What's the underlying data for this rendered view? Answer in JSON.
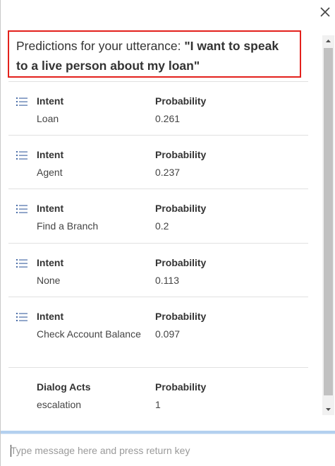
{
  "header": {
    "prefix": "Predictions for your utterance: ",
    "utterance": "\"I want to speak to a live person about my loan\""
  },
  "rows": [
    {
      "has_icon": true,
      "label_header": "Intent",
      "value": "Loan",
      "prob_header": "Probability",
      "prob": "0.261"
    },
    {
      "has_icon": true,
      "label_header": "Intent",
      "value": "Agent",
      "prob_header": "Probability",
      "prob": "0.237"
    },
    {
      "has_icon": true,
      "label_header": "Intent",
      "value": "Find a Branch",
      "prob_header": "Probability",
      "prob": "0.2"
    },
    {
      "has_icon": true,
      "label_header": "Intent",
      "value": "None",
      "prob_header": "Probability",
      "prob": "0.113"
    },
    {
      "has_icon": true,
      "label_header": "Intent",
      "value": "Check Account Balance",
      "prob_header": "Probability",
      "prob": "0.097"
    },
    {
      "has_icon": false,
      "label_header": "Dialog Acts",
      "value": "escalation",
      "prob_header": "Probability",
      "prob": "1"
    }
  ],
  "composer": {
    "placeholder": "Type message here and press return key"
  },
  "colors": {
    "highlight_border": "#e3211c",
    "icon": "#4a6da7",
    "divider": "#b3d0ef"
  },
  "icons": {
    "close": "close-icon",
    "list": "list-icon",
    "scroll_up": "scroll-up-arrow-icon",
    "scroll_down": "scroll-down-arrow-icon"
  }
}
